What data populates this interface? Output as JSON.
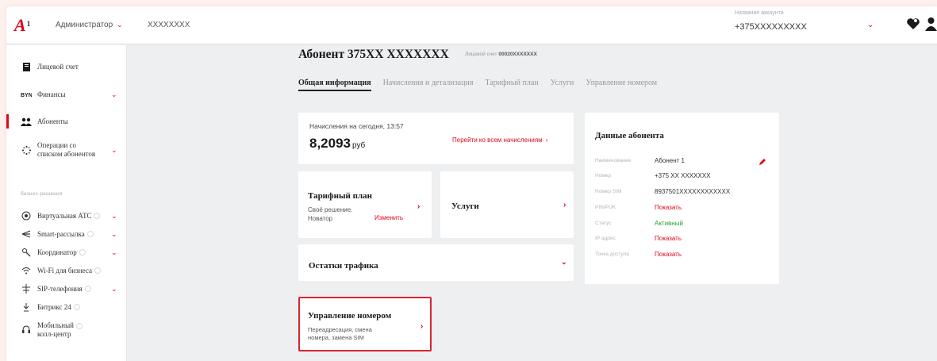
{
  "header": {
    "logo": "A",
    "logo_sup": "1",
    "role": "Администратор",
    "contract": "XXXXXXXX",
    "account_label": "Название аккаунта",
    "account_number": "+375XXXXXXXXX"
  },
  "sidebar": {
    "items": [
      {
        "label": "Лицевой счет"
      },
      {
        "label": "Финансы"
      },
      {
        "label": "Абоненты"
      },
      {
        "label_line1": "Операции со",
        "label_line2": "списком абонентов"
      },
      {
        "label": "Виртуальная АТС"
      },
      {
        "label": "Smart-рассылка"
      },
      {
        "label": "Координатор"
      },
      {
        "label": "Wi-Fi для бизнеса"
      },
      {
        "label": "SIP-телефония"
      },
      {
        "label": "Битрикс 24"
      },
      {
        "label_line1": "Мобильный",
        "label_line2": "колл-центр"
      }
    ],
    "section_label": "бизнес-решения"
  },
  "main": {
    "title": "Абонент 375XX XXXXXXX",
    "personal_account_label": "Лицевой счет",
    "personal_account_value": "00020XXXXXXX",
    "tabs": [
      {
        "label": "Общая информация"
      },
      {
        "label": "Начисления и детализация"
      },
      {
        "label": "Тарифный план"
      },
      {
        "label": "Услуги"
      },
      {
        "label": "Управление номером"
      }
    ]
  },
  "charges": {
    "label": "Начисления на сегодня, 13:57",
    "value": "8,2093",
    "unit": "руб",
    "link": "Перейти ко всем начислениям"
  },
  "tariff": {
    "title": "Тарифный план",
    "desc_line1": "Своё решение.",
    "desc_line2": "Новатор",
    "change_link": "Изменить"
  },
  "services": {
    "title": "Услуги"
  },
  "traffic": {
    "title": "Остатки трафика"
  },
  "number_mgmt": {
    "title": "Управление номером",
    "desc_line1": "Переадресация, смена",
    "desc_line2": "номера, замена SIM"
  },
  "subscriber": {
    "title": "Данные абонента",
    "rows": [
      {
        "label": "Наименование",
        "value": "Абонент 1"
      },
      {
        "label": "Номер",
        "value": "+375 XX XXXXXXX"
      },
      {
        "label": "Номер SIM",
        "value": "8937501XXXXXXXXXXXX"
      },
      {
        "label": "PIN/PUK",
        "value": "Показать"
      },
      {
        "label": "Статус",
        "value": "Активный"
      },
      {
        "label": "IP адрес",
        "value": "Показать"
      },
      {
        "label": "Точка доступа",
        "value": "Показать"
      }
    ]
  },
  "colors": {
    "brand": "#e0061b",
    "active_status": "#27a327",
    "highlight_border": "#d8262e"
  },
  "icons": [
    "user-icon",
    "heart-icon",
    "chevron-down-icon",
    "chevron-right-icon",
    "pencil-icon",
    "account-icon",
    "finance-icon",
    "subscribers-icon",
    "operations-icon",
    "pbx-icon",
    "broadcast-icon",
    "coordinator-icon",
    "wifi-icon",
    "sip-icon",
    "bitrix-icon",
    "call-center-icon"
  ]
}
